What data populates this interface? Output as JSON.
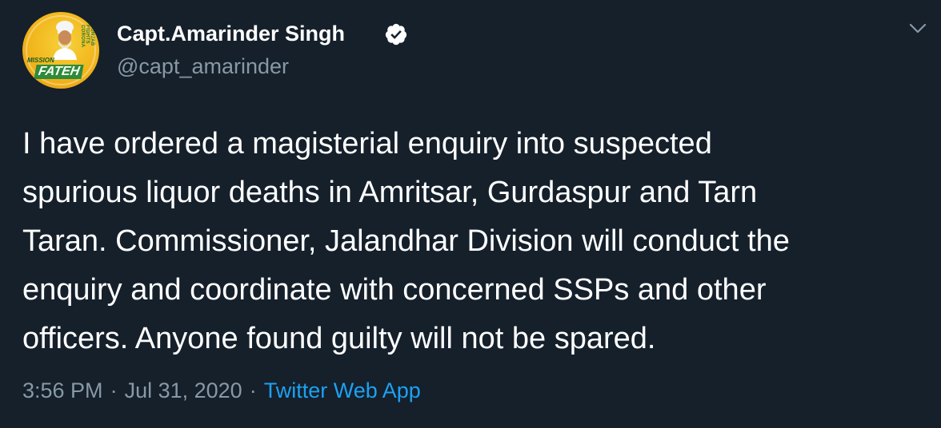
{
  "author": {
    "display_name": "Capt.Amarinder Singh",
    "handle": "@capt_amarinder",
    "verified": true,
    "avatar": {
      "badge_text": "MISSION",
      "title_text": "FATEH",
      "arc_text": "PUNJAB FIGHTS CORONA"
    }
  },
  "tweet": {
    "text": "I have ordered a magisterial enquiry into suspected\nspurious liquor deaths in Amritsar, Gurdaspur and Tarn\nTaran. Commissioner, Jalandhar Division will conduct the\nenquiry and coordinate with concerned SSPs and other\nofficers. Anyone found guilty will not be spared.",
    "time": "3:56 PM",
    "date": "Jul 31, 2020",
    "separator": "·",
    "source": "Twitter Web App"
  },
  "colors": {
    "background": "#15202b",
    "primary_text": "#ffffff",
    "secondary_text": "#8899a6",
    "link": "#1da1f2"
  },
  "icons": {
    "verified": "verified-badge-icon",
    "more": "chevron-down-icon"
  }
}
